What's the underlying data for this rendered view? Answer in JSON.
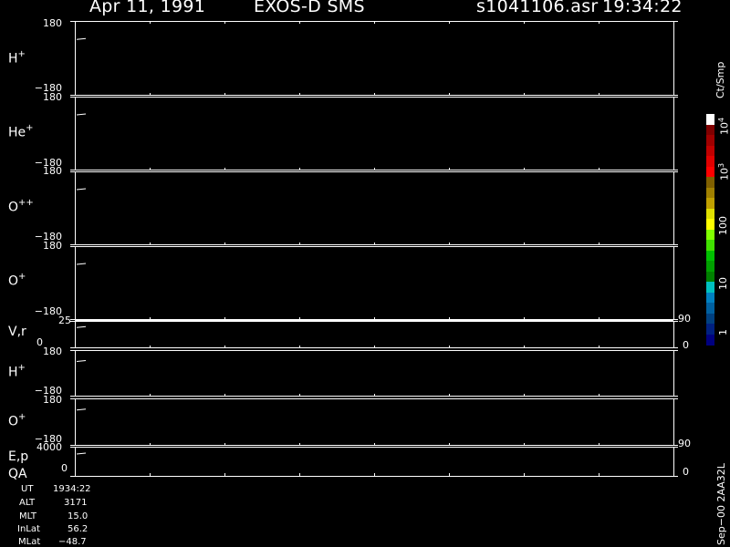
{
  "header": {
    "date": "Apr 11, 1991",
    "instrument": "EXOS-D SMS",
    "file": "s1041106.asr",
    "time": "19:34:22"
  },
  "colorbar": {
    "unit": "Ct/Smp",
    "labels": [
      {
        "text": "10",
        "sup": "4"
      },
      {
        "text": "10",
        "sup": "3"
      },
      {
        "text": "100",
        "sup": ""
      },
      {
        "text": "10",
        "sup": ""
      },
      {
        "text": "1",
        "sup": ""
      }
    ],
    "colors": [
      "#ffffff",
      "#800000",
      "#a00000",
      "#c00000",
      "#e00000",
      "#ff0000",
      "#806000",
      "#a08000",
      "#c0a000",
      "#e0e000",
      "#ffff00",
      "#80ff00",
      "#40e000",
      "#00c000",
      "#00a000",
      "#008000",
      "#00c0c0",
      "#0080c0",
      "#0060a0",
      "#004080",
      "#002080",
      "#000080"
    ]
  },
  "panels": [
    {
      "label": "H",
      "sup": "+",
      "top": "180",
      "bottom": "−180"
    },
    {
      "label": "He",
      "sup": "+",
      "top": "180",
      "bottom": "−180"
    },
    {
      "label": "O",
      "sup": "++",
      "top": "180",
      "bottom": "−180"
    },
    {
      "label": "O",
      "sup": "+",
      "top": "180",
      "bottom": "−180"
    },
    {
      "label": "V,r",
      "sup": "",
      "top": "25",
      "bottom": "0",
      "rtop": "90",
      "rbottom": "0"
    },
    {
      "label": "H",
      "sup": "+",
      "top": "180",
      "bottom": "−180"
    },
    {
      "label": "O",
      "sup": "+",
      "top": "180",
      "bottom": "−180"
    },
    {
      "label": "E,p",
      "label2": "QA",
      "sup": "",
      "top": "4000",
      "bottom": "0",
      "rtop": "90",
      "rbottom": "0"
    }
  ],
  "info": [
    {
      "key": "UT",
      "value": "1934:22"
    },
    {
      "key": "ALT",
      "value": "3171"
    },
    {
      "key": "MLT",
      "value": "15.0"
    },
    {
      "key": "InLat",
      "value": "56.2"
    },
    {
      "key": "MLat",
      "value": "−48.7"
    }
  ],
  "footer_stamp": "Sep−00  2AA32L",
  "chart_data": {
    "type": "heatmap",
    "title": "Apr 11, 1991   EXOS-D SMS   s1041106.asr  19:34:22",
    "panels": [
      "H+",
      "He+",
      "O++",
      "O+",
      "V,r",
      "H+",
      "O+",
      "E,p / QA"
    ],
    "colorbar_unit": "Ct/Smp",
    "colorbar_ticks": [
      "10^4",
      "10^3",
      "100",
      "10",
      "1"
    ],
    "values": []
  }
}
